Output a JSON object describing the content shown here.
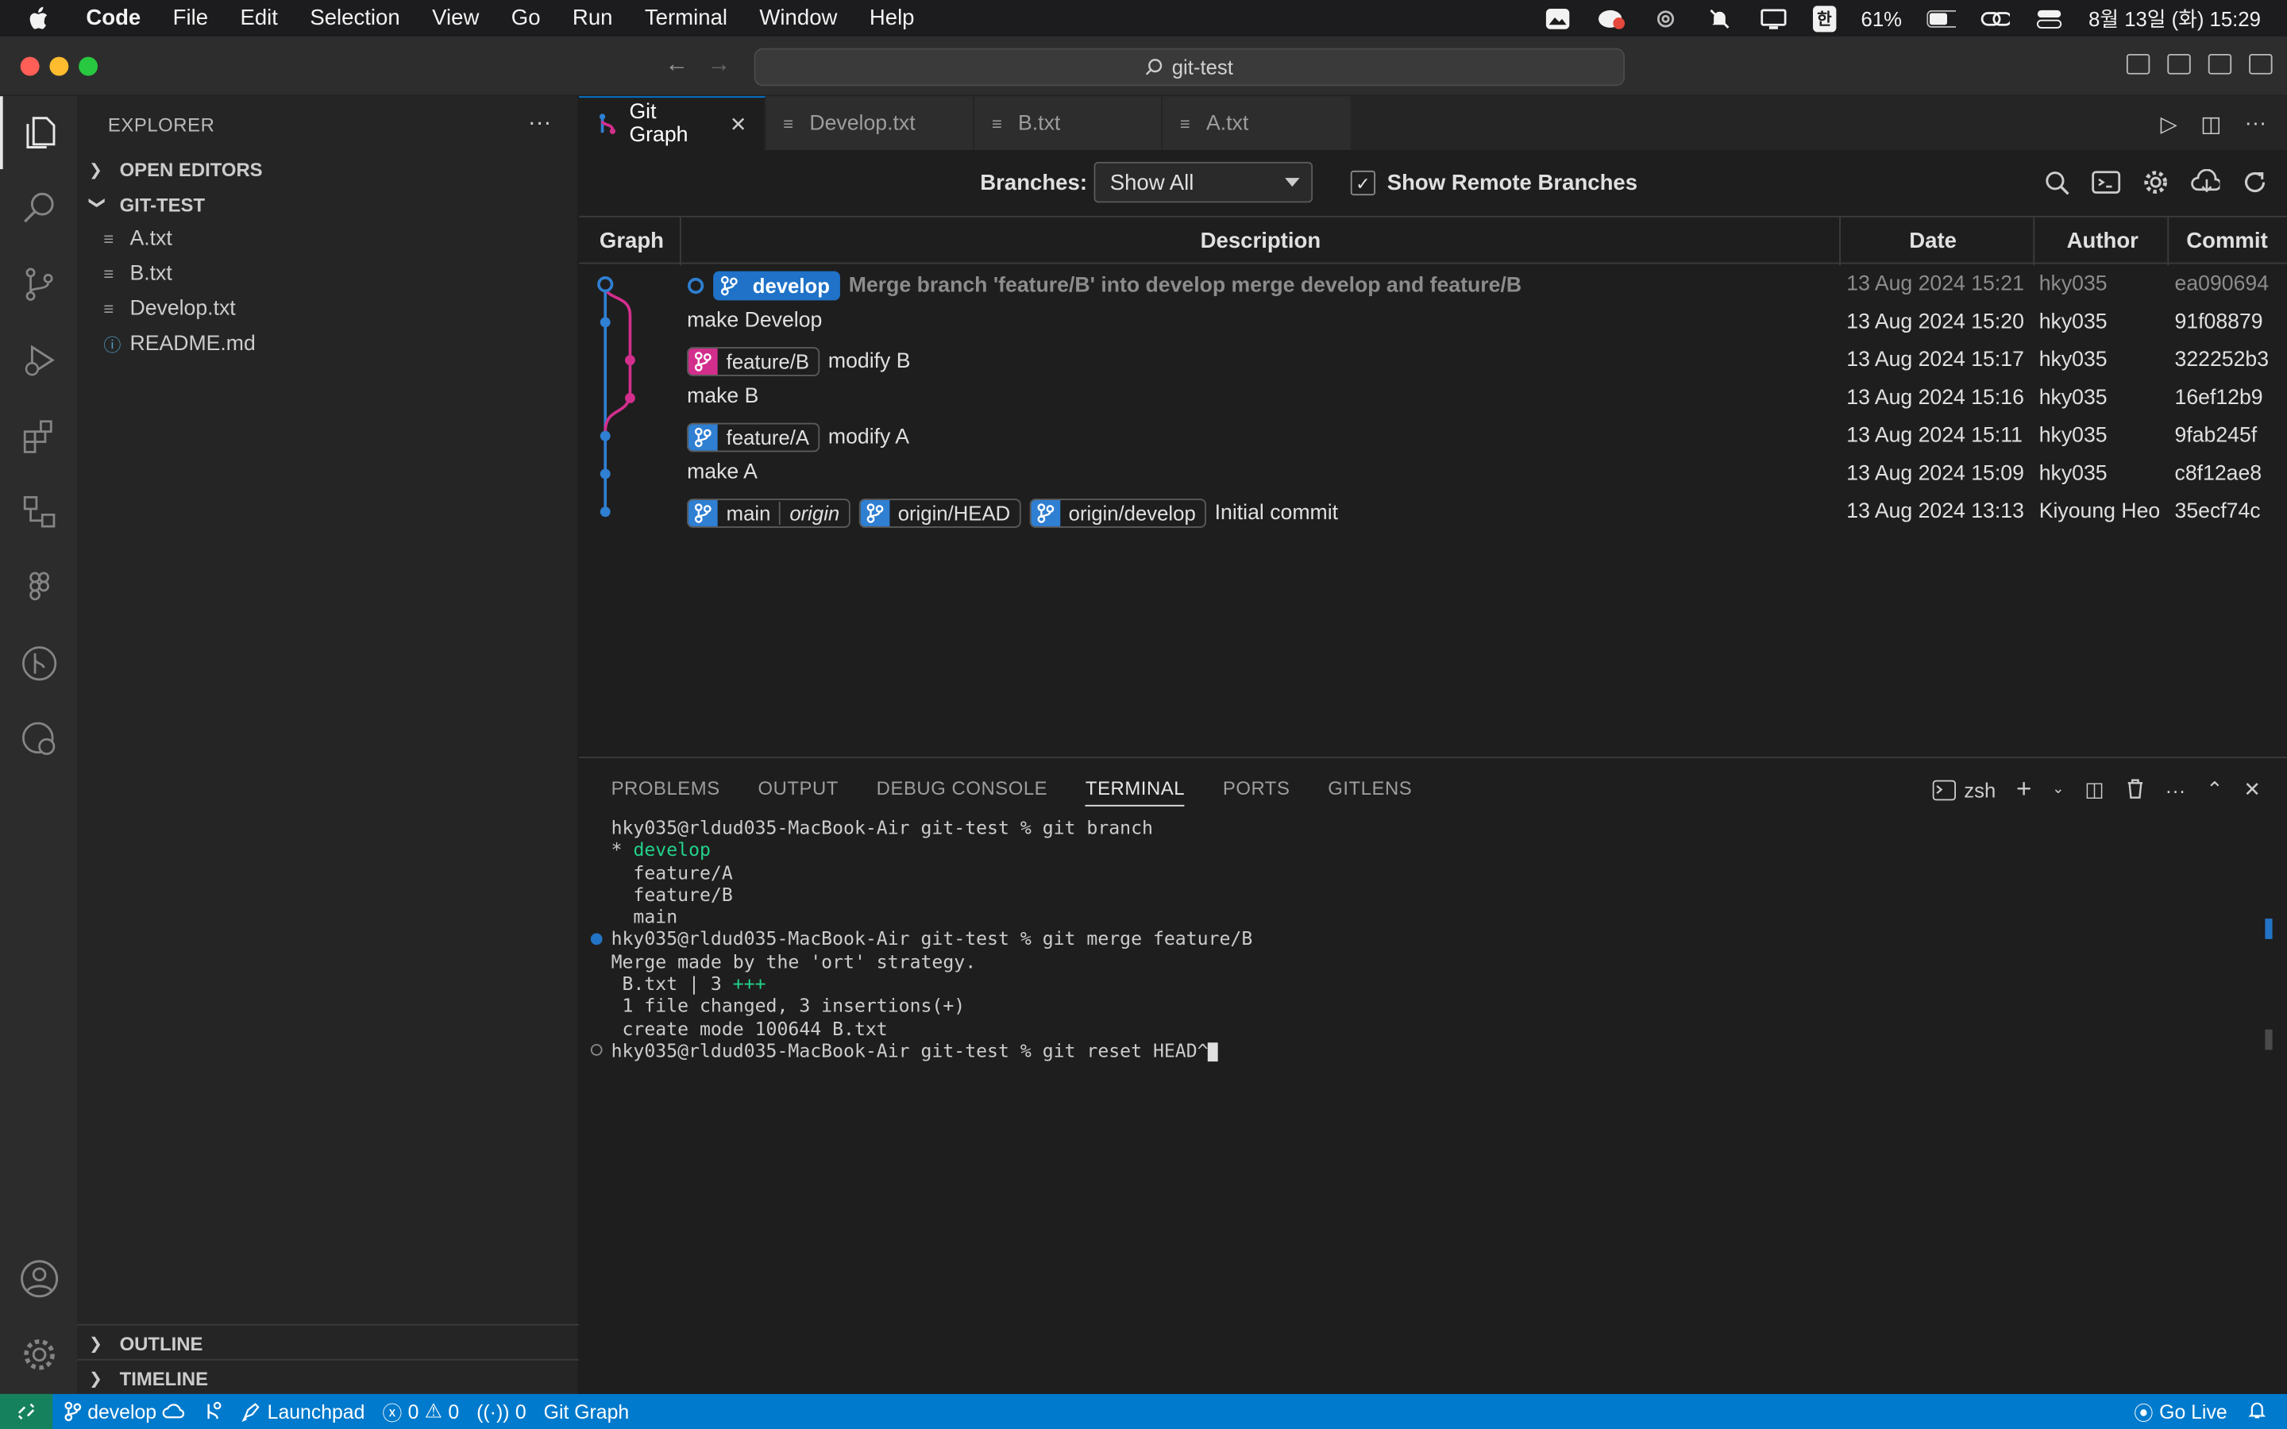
{
  "menubar": {
    "app_name": "Code",
    "menus": [
      "File",
      "Edit",
      "Selection",
      "View",
      "Go",
      "Run",
      "Terminal",
      "Window",
      "Help"
    ],
    "battery": "61%",
    "input_method": "한",
    "datetime": "8월 13일 (화) 15:29"
  },
  "titlebar": {
    "search_text": "git-test"
  },
  "sidebar": {
    "title": "EXPLORER",
    "open_editors": "OPEN EDITORS",
    "folder": "GIT-TEST",
    "files": [
      "A.txt",
      "B.txt",
      "Develop.txt",
      "README.md"
    ],
    "outline": "OUTLINE",
    "timeline": "TIMELINE"
  },
  "tabs": [
    {
      "label": "Git Graph",
      "active": true
    },
    {
      "label": "Develop.txt",
      "active": false
    },
    {
      "label": "B.txt",
      "active": false
    },
    {
      "label": "A.txt",
      "active": false
    }
  ],
  "git_graph": {
    "branches_label": "Branches:",
    "branches_value": "Show All",
    "remote_label": "Show Remote Branches",
    "remote_checked": true,
    "columns": [
      "Graph",
      "Description",
      "Date",
      "Author",
      "Commit"
    ],
    "commits": [
      {
        "refs": [
          {
            "name": "develop",
            "color": "#1f72c8",
            "active": true
          }
        ],
        "message": "Merge branch 'feature/B' into develop merge develop and feature/B",
        "date": "13 Aug 2024 15:21",
        "author": "hky035",
        "hash": "ea090694",
        "uncommitted": true
      },
      {
        "refs": [],
        "message": "make Develop",
        "date": "13 Aug 2024 15:20",
        "author": "hky035",
        "hash": "91f08879"
      },
      {
        "refs": [
          {
            "name": "feature/B",
            "color": "#d22f8d"
          }
        ],
        "message": "modify B",
        "date": "13 Aug 2024 15:17",
        "author": "hky035",
        "hash": "322252b3"
      },
      {
        "refs": [],
        "message": "make B",
        "date": "13 Aug 2024 15:16",
        "author": "hky035",
        "hash": "16ef12b9"
      },
      {
        "refs": [
          {
            "name": "feature/A",
            "color": "#2f7fd2"
          }
        ],
        "message": "modify A",
        "date": "13 Aug 2024 15:11",
        "author": "hky035",
        "hash": "9fab245f"
      },
      {
        "refs": [],
        "message": "make A",
        "date": "13 Aug 2024 15:09",
        "author": "hky035",
        "hash": "c8f12ae8"
      },
      {
        "refs": [
          {
            "name": "main",
            "remote": "origin",
            "color": "#2f7fd2"
          },
          {
            "name": "origin/HEAD",
            "color": "#2f7fd2"
          },
          {
            "name": "origin/develop",
            "color": "#2f7fd2"
          }
        ],
        "message": "Initial commit",
        "date": "13 Aug 2024 13:13",
        "author": "Kiyoung Heo",
        "hash": "35ecf74c"
      }
    ]
  },
  "panel": {
    "tabs": [
      "PROBLEMS",
      "OUTPUT",
      "DEBUG CONSOLE",
      "TERMINAL",
      "PORTS",
      "GITLENS"
    ],
    "active_tab": "TERMINAL",
    "shell": "zsh",
    "terminal_lines": [
      "hky035@rldud035-MacBook-Air git-test % git branch",
      "* develop",
      "  feature/A",
      "  feature/B",
      "  main",
      "hky035@rldud035-MacBook-Air git-test % git merge feature/B",
      "Merge made by the 'ort' strategy.",
      " B.txt | 3 +++",
      " 1 file changed, 3 insertions(+)",
      " create mode 100644 B.txt",
      "hky035@rldud035-MacBook-Air git-test % git reset HEAD^"
    ]
  },
  "statusbar": {
    "branch": "develop",
    "launchpad": "Launchpad",
    "errors": "0",
    "warnings": "0",
    "ports": "0",
    "git_graph": "Git Graph",
    "go_live": "Go Live"
  },
  "colors": {
    "accent": "#007acc",
    "branch_blue": "#2f7fd2",
    "branch_pink": "#d22f8d"
  }
}
